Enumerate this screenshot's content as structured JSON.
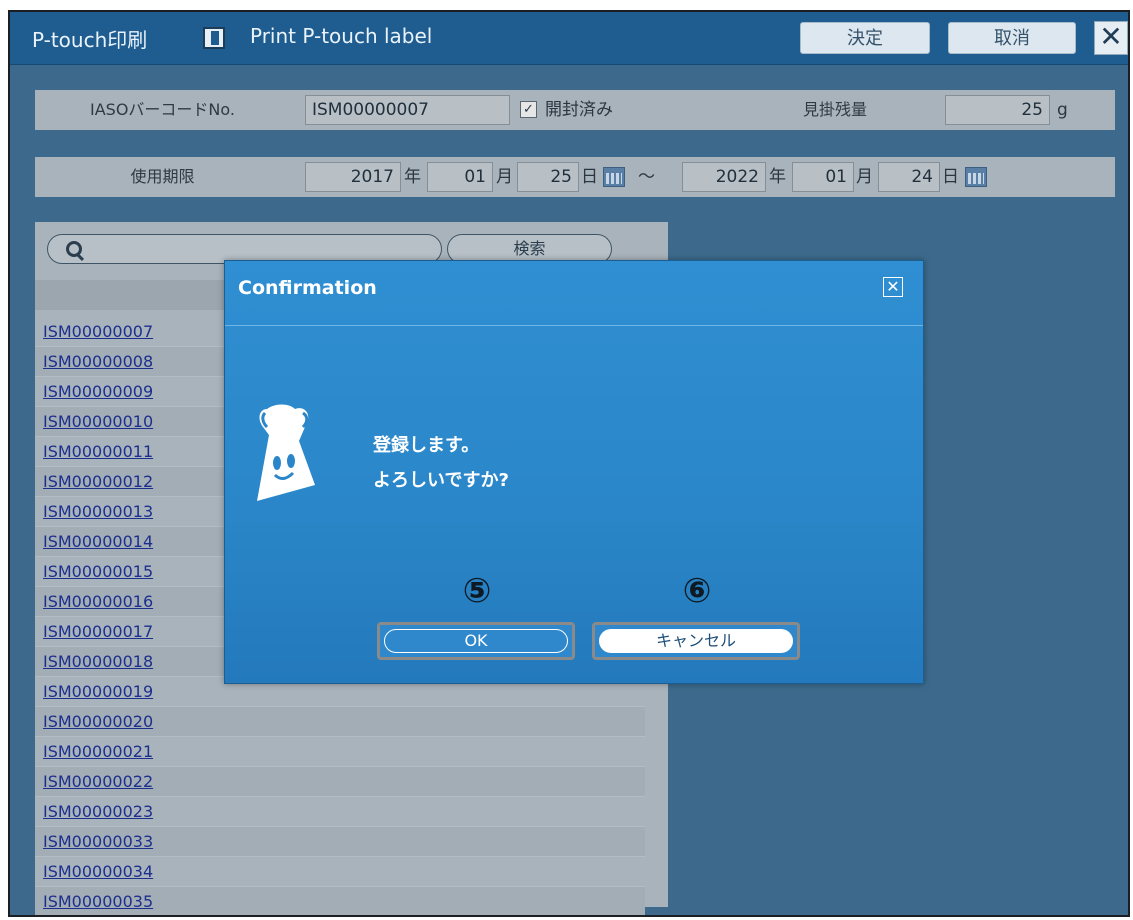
{
  "window": {
    "title_jp": "P-touch印刷",
    "title_en": "Print P-touch label",
    "decide_label": "決定",
    "cancel_label": "取消",
    "close_glyph": "✕"
  },
  "form": {
    "barcode_label": "IASOバーコードNo.",
    "barcode_value": "ISM00000007",
    "opened_checkbox_label": "開封済み",
    "opened_checked": true,
    "remaining_label": "見掛残量",
    "remaining_value": "25",
    "remaining_unit": "g",
    "expiry_label": "使用期限",
    "start": {
      "year": "2017",
      "month": "01",
      "day": "25"
    },
    "end": {
      "year": "2022",
      "month": "01",
      "day": "24"
    },
    "year_unit": "年",
    "month_unit": "月",
    "day_unit": "日",
    "tilde": "～"
  },
  "search": {
    "button_label": "検索"
  },
  "list": {
    "items": [
      "ISM00000007",
      "ISM00000008",
      "ISM00000009",
      "ISM00000010",
      "ISM00000011",
      "ISM00000012",
      "ISM00000013",
      "ISM00000014",
      "ISM00000015",
      "ISM00000016",
      "ISM00000017",
      "ISM00000018",
      "ISM00000019",
      "ISM00000020",
      "ISM00000021",
      "ISM00000022",
      "ISM00000023",
      "ISM00000033",
      "ISM00000034",
      "ISM00000035"
    ]
  },
  "modal": {
    "title": "Confirmation",
    "close_glyph": "✕",
    "message_line1": "登録します。",
    "message_line2": "よろしいですか?",
    "ok_label": "OK",
    "cancel_label": "キャンセル",
    "marker_ok": "⑤",
    "marker_cancel": "⑥"
  },
  "icons": {
    "search": "search-icon",
    "calendar": "calendar-icon",
    "mascot": "mascot-icon"
  },
  "colors": {
    "titlebar": "#1f5d90",
    "modal": "#2a86c8",
    "link": "#1c2f8d"
  }
}
